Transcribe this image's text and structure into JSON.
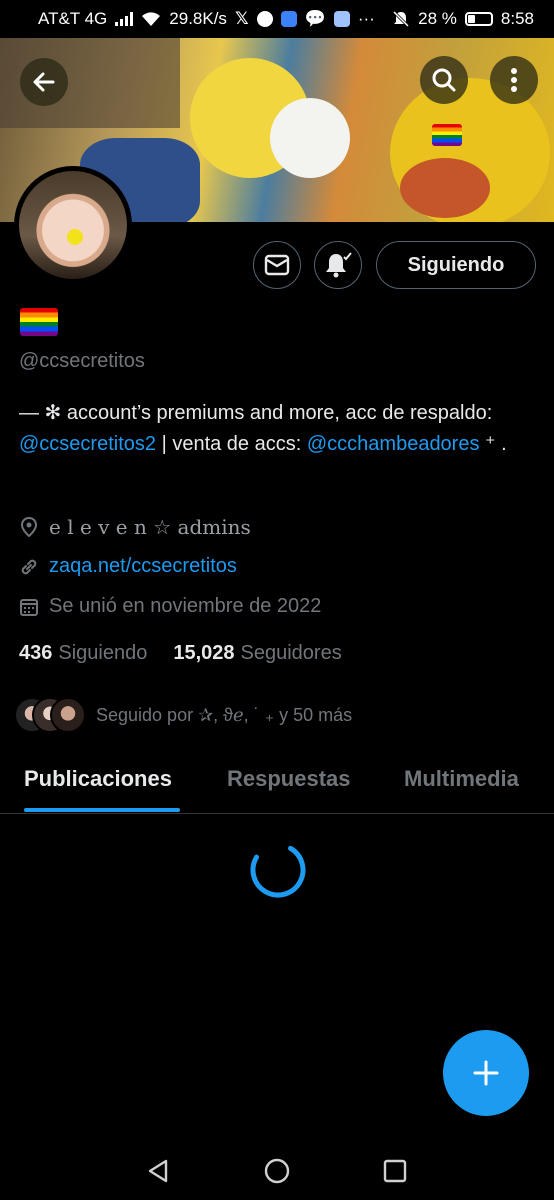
{
  "status_bar": {
    "carrier": "AT&T 4G",
    "speed": "29.8K/s",
    "battery": "28 %",
    "time": "8:58"
  },
  "profile": {
    "name_emoji": "rainbow-flag",
    "handle": "@ccsecretitos",
    "bio": {
      "part1": "— ✻ account’s premiums and more,     acc de respaldo: ",
      "link1": "@ccsecretitos2",
      "part2": " | venta de accs: ",
      "link2": "@ccchambeadores",
      "part3": " ⁺ ."
    },
    "location": "e l e v e n ☆ admins",
    "website": "zaqa.net/ccsecretitos",
    "joined": "Se unió en noviembre de 2022",
    "following_count": "436",
    "following_label": "Siguiendo",
    "followers_count": "15,028",
    "followers_label": "Seguidores",
    "followed_by": "Seguido por ✰, ϑℯ,  ˙ ₊ y 50 más"
  },
  "actions": {
    "follow_button": "Siguiendo"
  },
  "tabs": [
    {
      "label": "Publicaciones",
      "active": true
    },
    {
      "label": "Respuestas",
      "active": false
    },
    {
      "label": "Multimedia",
      "active": false
    }
  ],
  "colors": {
    "accent": "#1d9bf0",
    "background": "#000000",
    "muted": "#71767b"
  }
}
